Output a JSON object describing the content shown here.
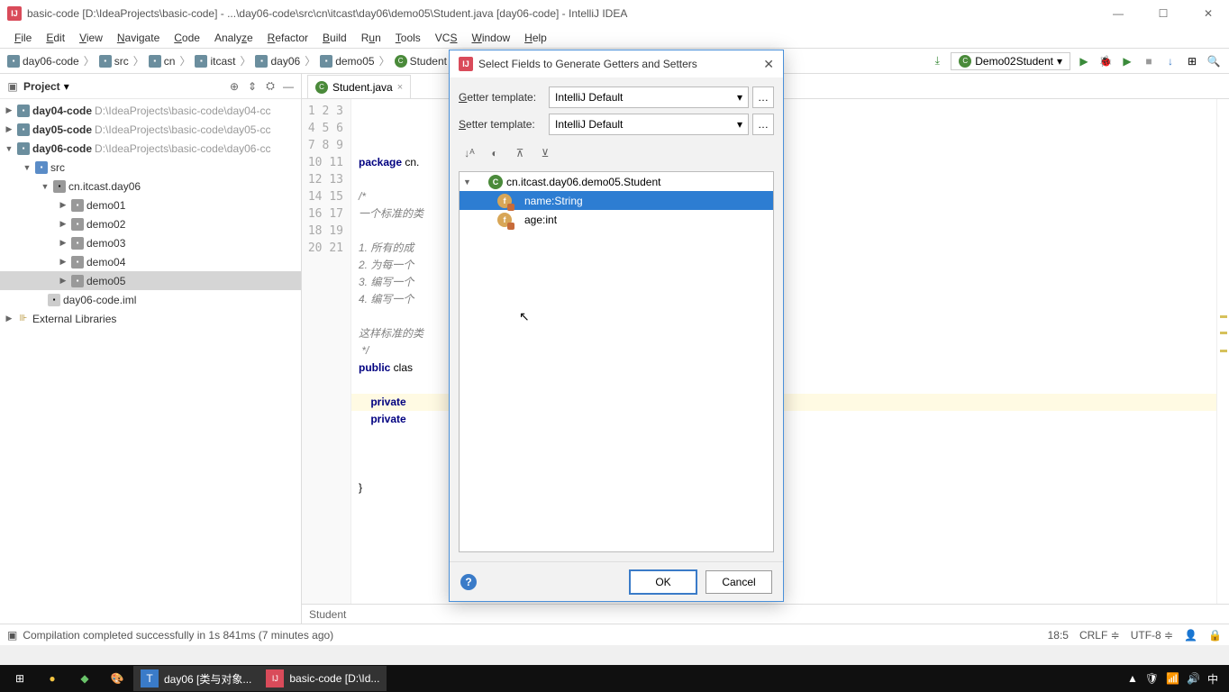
{
  "titlebar": {
    "text": "basic-code [D:\\IdeaProjects\\basic-code] - ...\\day06-code\\src\\cn\\itcast\\day06\\demo05\\Student.java [day06-code] - IntelliJ IDEA"
  },
  "menu": [
    "File",
    "Edit",
    "View",
    "Navigate",
    "Code",
    "Analyze",
    "Refactor",
    "Build",
    "Run",
    "Tools",
    "VCS",
    "Window",
    "Help"
  ],
  "breadcrumb": [
    "day06-code",
    "src",
    "cn",
    "itcast",
    "day06",
    "demo05",
    "Student"
  ],
  "run_config": "Demo02Student",
  "project_panel": {
    "title": "Project"
  },
  "tree": {
    "day04": {
      "label": "day04-code",
      "path": "D:\\IdeaProjects\\basic-code\\day04-cc"
    },
    "day05": {
      "label": "day05-code",
      "path": "D:\\IdeaProjects\\basic-code\\day05-cc"
    },
    "day06": {
      "label": "day06-code",
      "path": "D:\\IdeaProjects\\basic-code\\day06-cc"
    },
    "src": "src",
    "pkg": "cn.itcast.day06",
    "demo01": "demo01",
    "demo02": "demo02",
    "demo03": "demo03",
    "demo04": "demo04",
    "demo05": "demo05",
    "iml": "day06-code.iml",
    "ext": "External Libraries"
  },
  "editor": {
    "tab": "Student.java",
    "footer_crumb": "Student",
    "lines": {
      "l1": "package cn.",
      "l3": "/*",
      "l4": "一个标准的类",
      "l6": "1. 所有的成",
      "l7": "2. 为每一个",
      "l8": "3. 编写一个",
      "l9": "4. 编写一个",
      "l11": "这样标准的类",
      "l12": " */",
      "l13a": "public",
      "l13b": " clas",
      "l15a": "    private",
      "l16a": "    private",
      "l20": "}"
    },
    "line_count": 21
  },
  "dialog": {
    "title": "Select Fields to Generate Getters and Setters",
    "getter_label": "Getter template:",
    "setter_label": "Setter template:",
    "getter_value": "IntelliJ Default",
    "setter_value": "IntelliJ Default",
    "class_node": "cn.itcast.day06.demo05.Student",
    "field1": "name:String",
    "field2": "age:int",
    "ok": "OK",
    "cancel": "Cancel"
  },
  "statusbar": {
    "msg": "Compilation completed successfully in 1s 841ms (7 minutes ago)",
    "pos": "18:5",
    "crlf": "CRLF",
    "enc": "UTF-8"
  },
  "taskbar": {
    "item1": "day06 [类与对象...",
    "item2": "basic-code [D:\\Id...",
    "ime": "中"
  }
}
